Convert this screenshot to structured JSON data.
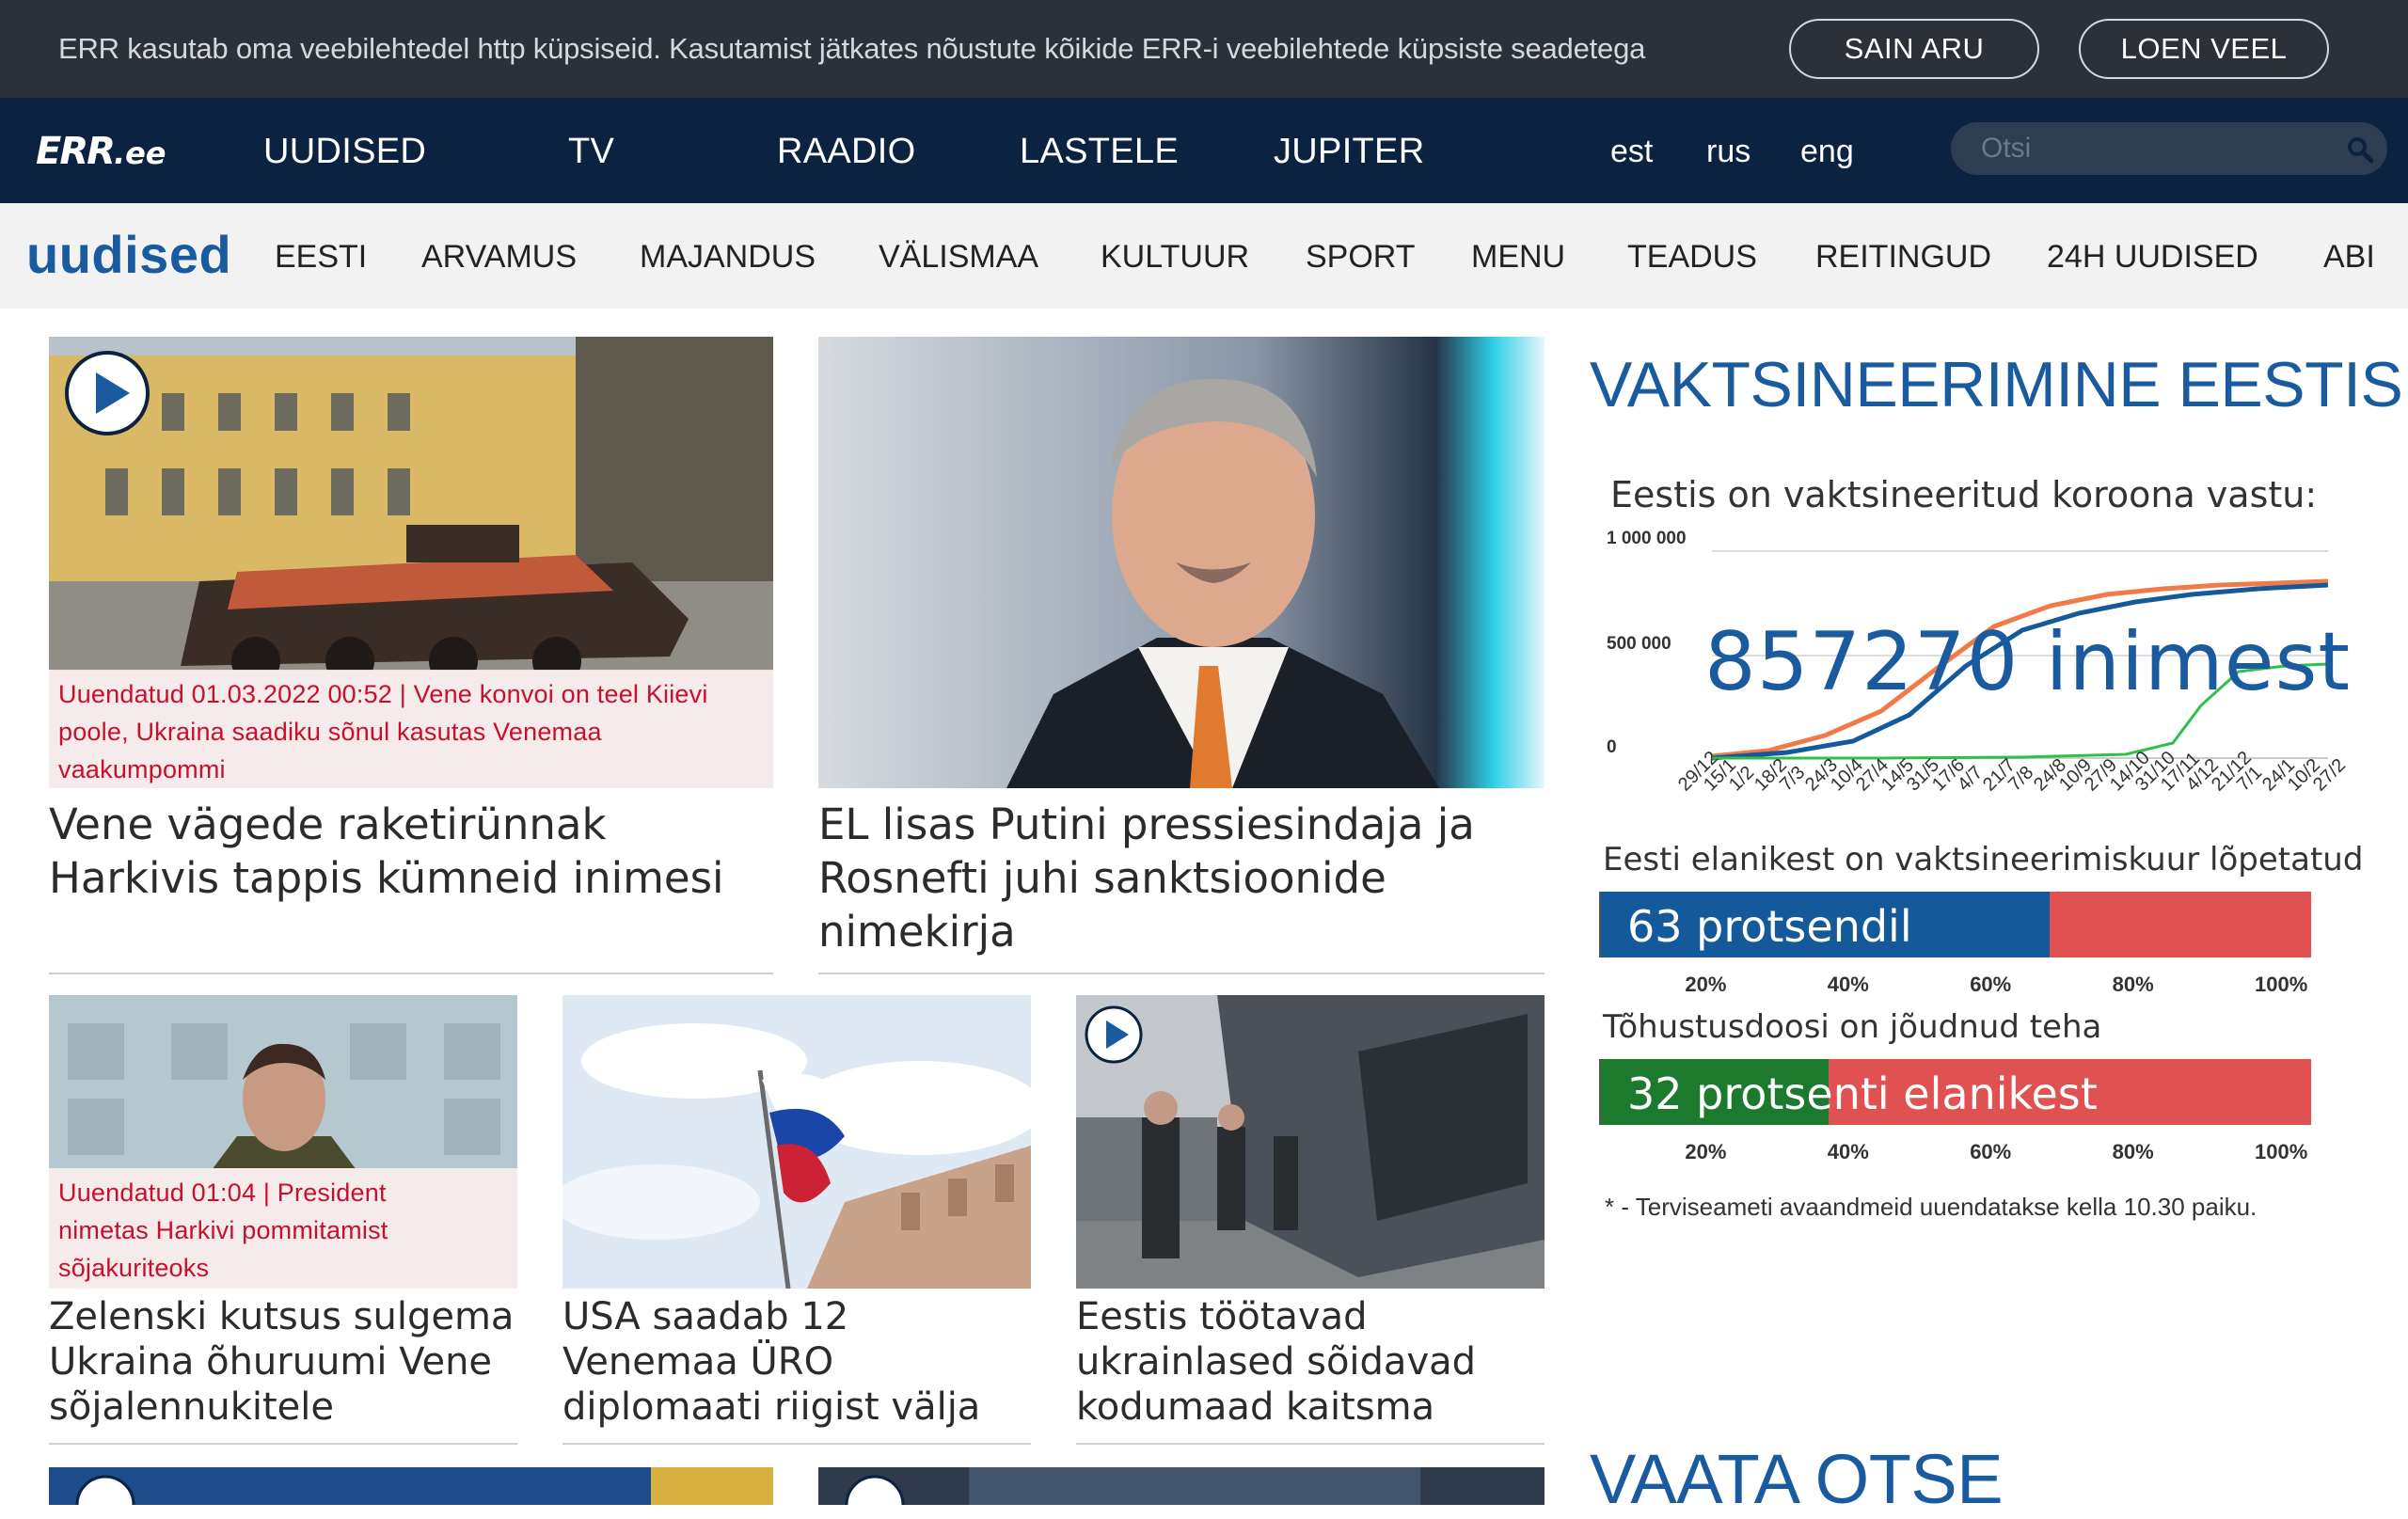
{
  "cookie": {
    "text": "ERR kasutab oma veebilehtedel http küpsiseid. Kasutamist jätkates nõustute kõikide ERR-i veebilehtede küpsiste seadetega",
    "accept_label": "SAIN ARU",
    "more_label": "LOEN VEEL"
  },
  "nav": {
    "logo_main": "ERR",
    "logo_suffix": ".ee",
    "items": [
      "UUDISED",
      "TV",
      "RAADIO",
      "LASTELE",
      "JUPITER"
    ],
    "languages": [
      "est",
      "rus",
      "eng"
    ],
    "search_placeholder": "Otsi"
  },
  "subnav": {
    "section_title": "uudised",
    "items": [
      "EESTI",
      "ARVAMUS",
      "MAJANDUS",
      "VÄLISMAA",
      "KULTUUR",
      "SPORT",
      "MENU",
      "TEADUS",
      "REITINGUD",
      "24H UUDISED",
      "ABI"
    ]
  },
  "articles": [
    {
      "update": "Uuendatud 01.03.2022 00:52 | Vene konvoi on teel Kiievi poole, Ukraina saadiku sõnul kasutas Venemaa vaakumpommi",
      "title": "Vene vägede raketirünnak Harkivis tappis kümneid inimesi"
    },
    {
      "title": "EL lisas Putini pressiesindaja ja Rosnefti juhi sanktsioonide nimekirja"
    },
    {
      "update": "Uuendatud 01:04 | President nimetas Harkivi pommitamist sõjakuriteoks",
      "title": "Zelenski kutsus sulgema Ukraina õhuruumi Vene sõjalennukitele"
    },
    {
      "title": "USA saadab 12 Venemaa ÜRO diplomaati riigist välja"
    },
    {
      "title": "Eestis töötavad ukrainlased sõidavad kodumaad kaitsma"
    }
  ],
  "vaccination": {
    "title": "VAKTSINEERIMINE EESTIS",
    "subtitle": "Eestis on vaktsineeritud koroona vastu:",
    "y_ticks": [
      "1 000 000",
      "500 000",
      "0"
    ],
    "big_number": "857270 inimest",
    "x_ticks": [
      "29/12",
      "15/1",
      "1/2",
      "18/2",
      "7/3",
      "24/3",
      "10/4",
      "27/4",
      "14/5",
      "31/5",
      "17/6",
      "4/7",
      "21/7",
      "7/8",
      "24/8",
      "10/9",
      "27/9",
      "14/10",
      "31/10",
      "17/11",
      "4/12",
      "21/12",
      "7/1",
      "24/1",
      "10/2",
      "27/2"
    ],
    "completed_label": "Eesti elanikest on vaktsineerimiskuur lõpetatud",
    "completed_text": "63 protsendil",
    "completed_percent": 63,
    "booster_label": "Tõhustusdoosi on jõudnud teha",
    "booster_text": "32 protsenti elanikest",
    "booster_percent": 32,
    "percent_ticks": [
      "20%",
      "40%",
      "60%",
      "80%",
      "100%"
    ],
    "note": "* - Terviseameti avaandmeid uuendatakse kella 10.30 paiku.",
    "colors": {
      "blue": "#14599a",
      "green": "#1c7a2e",
      "red": "#e05252",
      "orange": "#f07a4a",
      "line_green": "#2fbf4a"
    }
  },
  "live": {
    "title": "VAATA OTSE"
  }
}
